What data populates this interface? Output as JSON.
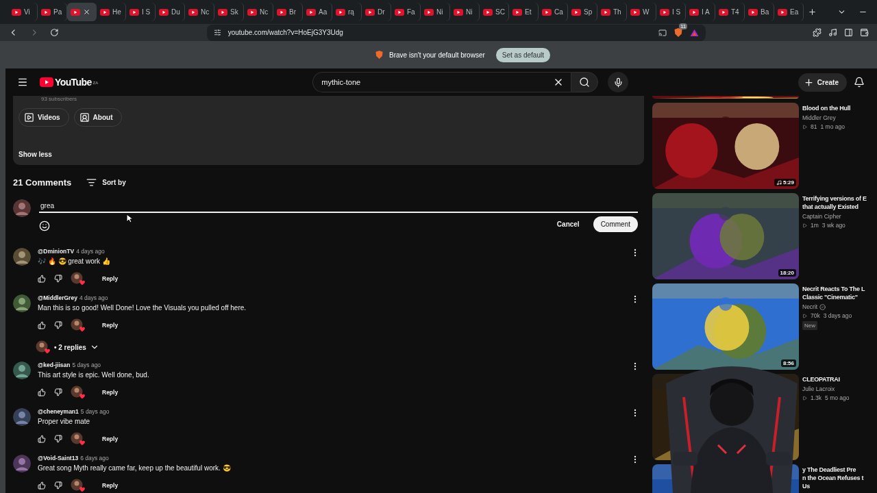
{
  "browser": {
    "tabs": [
      {
        "label": "Vi",
        "selected": false
      },
      {
        "label": "Pa",
        "selected": false
      },
      {
        "selected": true
      },
      {
        "label": "He",
        "selected": false
      },
      {
        "label": "I S",
        "selected": false
      },
      {
        "label": "Du",
        "selected": false
      },
      {
        "label": "Nc",
        "selected": false
      },
      {
        "label": "Sk",
        "selected": false
      },
      {
        "label": "Nc",
        "selected": false
      },
      {
        "label": "Br",
        "selected": false
      },
      {
        "label": "Aa",
        "selected": false
      },
      {
        "label": "rą",
        "selected": false
      },
      {
        "label": "Dr",
        "selected": false
      },
      {
        "label": "Fa",
        "selected": false
      },
      {
        "label": "Ni",
        "selected": false
      },
      {
        "label": "Ni",
        "selected": false
      },
      {
        "label": "SC",
        "selected": false
      },
      {
        "label": "Et",
        "selected": false
      },
      {
        "label": "Ca",
        "selected": false
      },
      {
        "label": "Sp",
        "selected": false
      },
      {
        "label": "Th",
        "selected": false
      },
      {
        "label": "W",
        "selected": false
      },
      {
        "label": "I S",
        "selected": false
      },
      {
        "label": "I A",
        "selected": false
      },
      {
        "label": "T4",
        "selected": false
      },
      {
        "label": "Ba",
        "selected": false
      },
      {
        "label": "Ea",
        "selected": false
      }
    ],
    "url": "youtube.com/watch?v=HoEjG3Y3Udg",
    "shield_count": "11",
    "infobar": {
      "message": "Brave isn't your default browser",
      "button": "Set as default"
    }
  },
  "header": {
    "logo": "YouTube",
    "region": "ZA",
    "search": "mythic-tone",
    "create": "Create"
  },
  "channel": {
    "subscribers": "93 subscribers",
    "buttons": [
      "Videos",
      "About"
    ],
    "show_less": "Show less"
  },
  "comments": {
    "count": "21 Comments",
    "sort": "Sort by",
    "draft": "grea",
    "cancel": "Cancel",
    "submit": "Comment",
    "items": [
      {
        "author": "@DminionTV",
        "time": "4 days ago",
        "text": "🎶 🔥 😎 great work 👍",
        "reply": "Reply"
      },
      {
        "author": "@MiddlerGrey",
        "time": "4 days ago",
        "text": "Man this is so good! Well Done! Love the Visuals you pulled off here.",
        "reply": "Reply",
        "replies": "• 2 replies"
      },
      {
        "author": "@ked-jiisan",
        "time": "5 days ago",
        "text": "This art style is epic. Well done, bud.",
        "reply": "Reply"
      },
      {
        "author": "@cheneyman1",
        "time": "5 days ago",
        "text": "Proper vibe mate",
        "reply": "Reply"
      },
      {
        "author": "@Void-Saint13",
        "time": "6 days ago",
        "text": "Great song Myth really came far, keep up the beautiful work. 😎",
        "reply": "Reply"
      }
    ]
  },
  "sidebar": {
    "videos": [
      {
        "title": "Blood on the Hull",
        "channel": "Middler Grey",
        "verified": false,
        "views": "81",
        "age": "1 mo ago",
        "duration": "5:29",
        "music": true
      },
      {
        "title": "Terrifying versions of E\nthat actually Existed",
        "channel": "Captain Cipher",
        "verified": false,
        "views": "1m",
        "age": "3 wk ago",
        "duration": "18:20",
        "music": false
      },
      {
        "title": "Necrit Reacts To The L\nClassic \"Cinematic\"",
        "channel": "Necrit",
        "verified": true,
        "views": "70k",
        "age": "3 days ago",
        "badge": "New",
        "duration": "8:56",
        "music": false
      },
      {
        "title": "CLEOPATRAI",
        "channel": "Julie Lacroix",
        "verified": false,
        "views": "1.3k",
        "age": "5 mo ago",
        "music": false
      },
      {
        "title": "y The Deadliest Pre\nn the Ocean Refuses t\nUs",
        "music": false
      }
    ]
  }
}
